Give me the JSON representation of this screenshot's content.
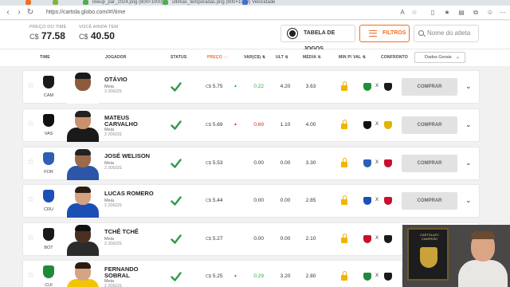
{
  "browser": {
    "tabs": [
      {
        "label": "",
        "favicon_color": "#f26b21"
      },
      {
        "label": "",
        "favicon_color": "#7cb342"
      },
      {
        "label": "lineup_par_2024.png (800×1000)",
        "favicon_color": "#4caf50"
      },
      {
        "label": "ultimas_temporadas.png (800×1000)",
        "favicon_color": "#4caf50"
      },
      {
        "label": "Velocidade",
        "favicon_color": "#3d6fd9"
      }
    ],
    "url": "https://cartola.globo.com/#!/time"
  },
  "header": {
    "time_price_label": "Preço do time",
    "time_price_currency": "C$",
    "time_price_value": "77.58",
    "remaining_label": "Você ainda tem",
    "remaining_currency": "C$",
    "remaining_value": "40.50",
    "tabela_button": "Tabela de jogos",
    "filtros_button": "Filtros",
    "search_placeholder": "Nome do atleta"
  },
  "columns": {
    "time": "Time",
    "jogador": "Jogador",
    "status": "Status",
    "preco": "Preço ↑↓",
    "var": "Var(C$) ⇅",
    "ult": "Ult ⇅",
    "media": "Média ⇅",
    "min_val": "Min p/ val ⇅",
    "confronto": "Confronto",
    "dados_select": "Dados Gerais"
  },
  "rows": [
    {
      "team": "CAM",
      "team_color": "#1a1a1a",
      "name_line1": "Otávio",
      "name_line2": "",
      "position": "Meia",
      "games": "3 jogos",
      "price": "5.75",
      "trend": "▲",
      "trend_color": "#2fa84f",
      "var": "0.22",
      "var_color": "#2fa84f",
      "ult": "4.20",
      "media": "3.63",
      "home_color": "#1f8f3a",
      "away_color": "#1a1a1a",
      "skin": "#8d5a3b",
      "hair": "#1a1a1a",
      "shirt": "#ffffff"
    },
    {
      "team": "VAS",
      "team_color": "#111111",
      "name_line1": "Mateus",
      "name_line2": "Carvalho",
      "position": "Meia",
      "games": "3 jogos",
      "price": "5.69",
      "trend": "▲",
      "trend_color": "#d9342b",
      "var": "0.69",
      "var_color": "#d9342b",
      "ult": "1.10",
      "media": "4.00",
      "home_color": "#111111",
      "away_color": "#e2b300",
      "skin": "#c9916b",
      "hair": "#222222",
      "shirt": "#1a1a1a"
    },
    {
      "team": "FOR",
      "team_color": "#2e5fb3",
      "name_line1": "José Welison",
      "name_line2": "",
      "position": "Meia",
      "games": "2 jogos",
      "price": "5.53",
      "trend": "",
      "trend_color": "#333333",
      "var": "0.00",
      "var_color": "#333333",
      "ult": "0.00",
      "media": "3.30",
      "home_color": "#2e5fb3",
      "away_color": "#c8102e",
      "skin": "#9a6a4c",
      "hair": "#222222",
      "shirt": "#2d55a8"
    },
    {
      "team": "CRU",
      "team_color": "#1c4fb8",
      "name_line1": "Lucas Romero",
      "name_line2": "",
      "position": "Meia",
      "games": "2 jogos",
      "price": "5.44",
      "trend": "",
      "trend_color": "#333333",
      "var": "0.00",
      "var_color": "#333333",
      "ult": "0.00",
      "media": "2.85",
      "home_color": "#1c4fb8",
      "away_color": "#c8102e",
      "skin": "#d4a282",
      "hair": "#2a1d15",
      "shirt": "#1b4fb5"
    },
    {
      "team": "BOT",
      "team_color": "#1a1a1a",
      "name_line1": "Tchê Tchê",
      "name_line2": "",
      "position": "Meia",
      "games": "2 jogos",
      "price": "5.27",
      "trend": "",
      "trend_color": "#333333",
      "var": "0.00",
      "var_color": "#333333",
      "ult": "0.00",
      "media": "2.10",
      "home_color": "#c8102e",
      "away_color": "#1a1a1a",
      "skin": "#4a2f22",
      "hair": "#111111",
      "shirt": "#2b2b2b"
    },
    {
      "team": "CUI",
      "team_color": "#1f8a3b",
      "name_line1": "Fernando",
      "name_line2": "Sobral",
      "position": "Meia",
      "games": "2 jogos",
      "price": "5.25",
      "trend": "▲",
      "trend_color": "#2fa84f",
      "var": "0.29",
      "var_color": "#2fa84f",
      "ult": "3.20",
      "media": "2.80",
      "home_color": "#1f8a3b",
      "away_color": "#1a1a1a",
      "skin": "#d6a483",
      "hair": "#2b1c12",
      "shirt": "#f2c500"
    }
  ],
  "row_labels": {
    "status_icon": "check",
    "price_currency": "C$",
    "buy_button": "Comprar",
    "versus": "X"
  },
  "overlay": {
    "frame_title": "CARTOLAFC CAMPEÃO"
  }
}
